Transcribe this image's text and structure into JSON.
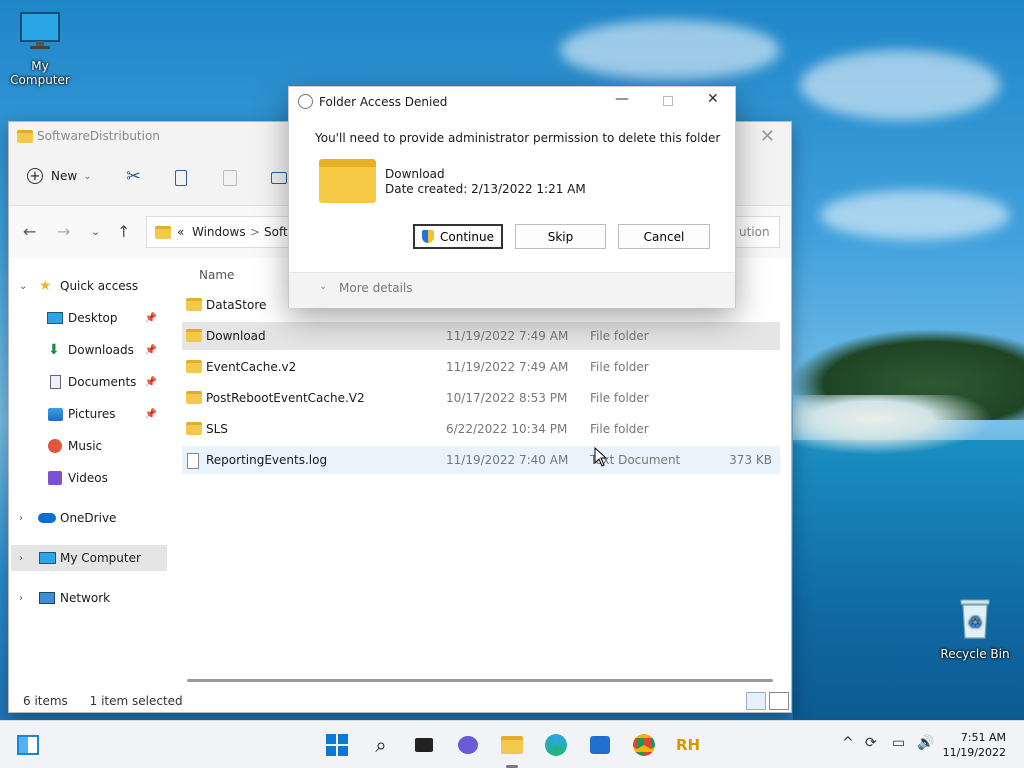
{
  "desktop": {
    "my_computer": "My Computer",
    "recycle_bin": "Recycle Bin"
  },
  "explorer": {
    "title": "SoftwareDistribution",
    "close": "✕",
    "toolbar": {
      "new_label": "New",
      "new_chevron": "⌄"
    },
    "address": {
      "prefix": "«",
      "crumb1": "Windows",
      "sep": ">",
      "crumb2": "Softw",
      "search_tail": "ution"
    },
    "sidebar": {
      "quick_access": "Quick access",
      "items": [
        {
          "label": "Desktop"
        },
        {
          "label": "Downloads"
        },
        {
          "label": "Documents"
        },
        {
          "label": "Pictures"
        },
        {
          "label": "Music"
        },
        {
          "label": "Videos"
        }
      ],
      "onedrive": "OneDrive",
      "my_computer": "My Computer",
      "network": "Network"
    },
    "columns": {
      "name": "Name"
    },
    "files": [
      {
        "name": "DataStore",
        "date": "",
        "type": "",
        "size": ""
      },
      {
        "name": "Download",
        "date": "11/19/2022 7:49 AM",
        "type": "File folder",
        "size": ""
      },
      {
        "name": "EventCache.v2",
        "date": "11/19/2022 7:49 AM",
        "type": "File folder",
        "size": ""
      },
      {
        "name": "PostRebootEventCache.V2",
        "date": "10/17/2022 8:53 PM",
        "type": "File folder",
        "size": ""
      },
      {
        "name": "SLS",
        "date": "6/22/2022 10:34 PM",
        "type": "File folder",
        "size": ""
      },
      {
        "name": "ReportingEvents.log",
        "date": "11/19/2022 7:40 AM",
        "type": "Text Document",
        "size": "373 KB"
      }
    ],
    "status": {
      "count": "6 items",
      "selected": "1 item selected"
    }
  },
  "dialog": {
    "title": "Folder Access Denied",
    "message": "You'll need to provide administrator permission to delete this folder",
    "folder_name": "Download",
    "date_created": "Date created: 2/13/2022 1:21 AM",
    "continue_label": "Continue",
    "skip_label": "Skip",
    "cancel_label": "Cancel",
    "more_details": "More details",
    "minimize": "—",
    "close": "✕"
  },
  "taskbar": {
    "time": "7:51 AM",
    "date": "11/19/2022"
  }
}
